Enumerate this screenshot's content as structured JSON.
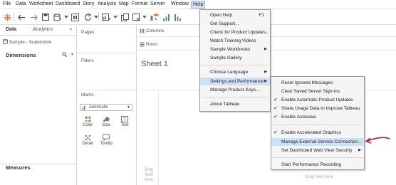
{
  "menubar": {
    "items": [
      "File",
      "Data",
      "Worksheet",
      "Dashboard",
      "Story",
      "Analysis",
      "Map",
      "Format",
      "Server",
      "Window",
      "Help"
    ]
  },
  "datapane": {
    "tab_data": "Data",
    "tab_analytics": "Analytics",
    "source": "Sample - Superstore",
    "dimensions": "Dimensions",
    "measures": "Measures"
  },
  "cards": {
    "pages": "Pages",
    "filters": "Filters",
    "marks": "Marks",
    "mark_type": "Automatic",
    "buttons": [
      "Color",
      "Size",
      "Text",
      "Detail",
      "Tooltip"
    ]
  },
  "shelves": {
    "columns": "Columns",
    "rows": "Rows"
  },
  "sheet": {
    "title": "Sheet 1",
    "drop_field_left": "Drop field here",
    "drop_field_bottom": "Drop field here"
  },
  "help_menu": {
    "items": [
      {
        "label": "Open Help",
        "shortcut": "F1"
      },
      {
        "label": "Get Support..."
      },
      {
        "label": "Check for Product Updates..."
      },
      {
        "label": "Watch Training Videos"
      },
      {
        "label": "Sample Workbooks"
      },
      {
        "label": "Sample Gallery"
      },
      {
        "label": "Choose Language"
      },
      {
        "label": "Settings and Performance"
      },
      {
        "label": "Manage Product Keys..."
      },
      {
        "label": "About Tableau"
      }
    ]
  },
  "settings_menu": {
    "items": [
      {
        "label": "Reset Ignored Messages"
      },
      {
        "label": "Clear Saved Server Sign-ins"
      },
      {
        "label": "Enable Automatic Product Updates"
      },
      {
        "label": "Share Usage Data to Improve Tableau"
      },
      {
        "label": "Enable Autosave"
      },
      {
        "label": "Enable Accelerated Graphics"
      },
      {
        "label": "Manage External Service Connection..."
      },
      {
        "label": "Set Dashboard Web View Security"
      },
      {
        "label": "Start Performance Recording"
      }
    ]
  },
  "colors": {
    "highlight": "#cde1f5",
    "checkmark": "#2a6cc4",
    "annotation_arrow": "#c0182a"
  }
}
